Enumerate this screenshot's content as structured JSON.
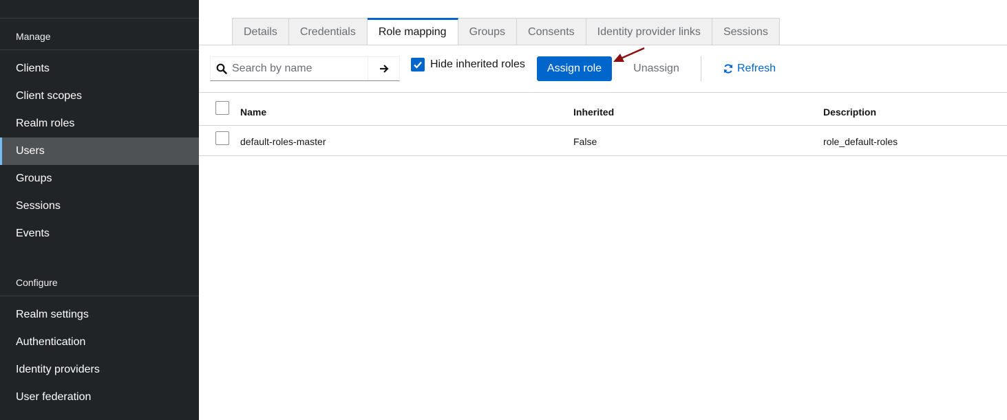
{
  "sidebar": {
    "manage_title": "Manage",
    "manage_items": [
      {
        "label": "Clients"
      },
      {
        "label": "Client scopes"
      },
      {
        "label": "Realm roles"
      },
      {
        "label": "Users"
      },
      {
        "label": "Groups"
      },
      {
        "label": "Sessions"
      },
      {
        "label": "Events"
      }
    ],
    "active_item": "Users",
    "configure_title": "Configure",
    "configure_items": [
      {
        "label": "Realm settings"
      },
      {
        "label": "Authentication"
      },
      {
        "label": "Identity providers"
      },
      {
        "label": "User federation"
      }
    ]
  },
  "tabs": [
    {
      "label": "Details"
    },
    {
      "label": "Credentials"
    },
    {
      "label": "Role mapping"
    },
    {
      "label": "Groups"
    },
    {
      "label": "Consents"
    },
    {
      "label": "Identity provider links"
    },
    {
      "label": "Sessions"
    }
  ],
  "active_tab": "Role mapping",
  "toolbar": {
    "search_placeholder": "Search by name",
    "search_value": "",
    "hide_inherited_label": "Hide inherited roles",
    "hide_inherited_checked": true,
    "assign_label": "Assign role",
    "unassign_label": "Unassign",
    "refresh_label": "Refresh"
  },
  "table": {
    "columns": [
      "Name",
      "Inherited",
      "Description"
    ],
    "rows": [
      {
        "name": "default-roles-master",
        "inherited": "False",
        "description": "role_default-roles"
      }
    ]
  },
  "colors": {
    "sidebar_bg": "#212427",
    "sidebar_active_bg": "#4f5255",
    "primary": "#0066cc",
    "annotation_arrow": "#8b0e10"
  },
  "icons": {
    "search": "search-icon",
    "go": "arrow-right-icon",
    "refresh": "sync-icon",
    "checkbox": "check-icon"
  }
}
